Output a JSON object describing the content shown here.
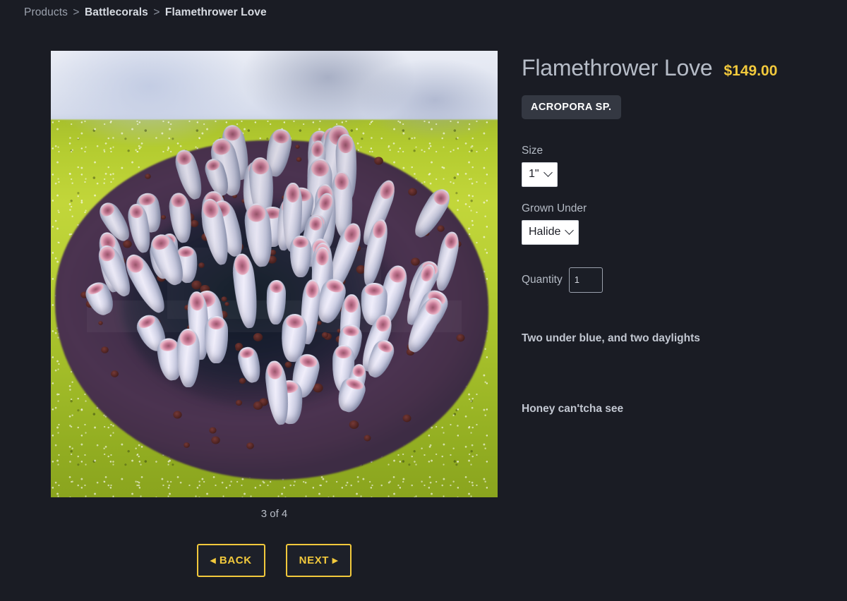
{
  "breadcrumb": {
    "items": [
      {
        "label": "Products",
        "strong": false
      },
      {
        "label": "Battlecorals",
        "strong": true
      },
      {
        "label": "Flamethrower Love",
        "strong": true
      }
    ],
    "separator": ">"
  },
  "gallery": {
    "image_alt": "Flamethrower Love Acropora coral colony photograph",
    "counter": "3 of 4",
    "back_label": "◂ BACK",
    "next_label": "NEXT ▸"
  },
  "product": {
    "title": "Flamethrower Love",
    "price": "$149.00",
    "badge": "ACROPORA SP."
  },
  "options": {
    "size": {
      "label": "Size",
      "value": "1\"",
      "options": [
        "1\""
      ]
    },
    "grown_under": {
      "label": "Grown Under",
      "value": "Halide",
      "options": [
        "Halide"
      ]
    },
    "quantity": {
      "label": "Quantity",
      "value": "1"
    }
  },
  "description": {
    "line1": "Two under blue, and two daylights",
    "line2": "Honey can'tcha see"
  },
  "colors": {
    "background": "#1a1c24",
    "accent_yellow": "#f2c93c",
    "text_primary": "#c8ccd4",
    "text_muted": "#9aa0ac",
    "badge_bg": "#343842"
  }
}
